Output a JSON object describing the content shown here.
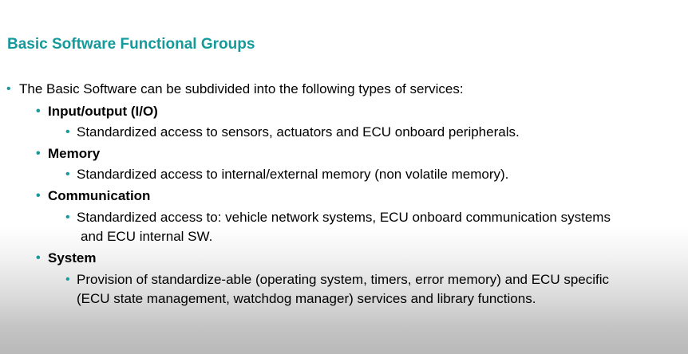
{
  "title": "Basic Software Functional Groups",
  "intro": "The Basic Software can be subdivided into the following types of services:",
  "groups": [
    {
      "name": "Input/output (I/O)",
      "details": [
        "Standardized access to sensors, actuators and ECU onboard peripherals."
      ]
    },
    {
      "name": "Memory",
      "details": [
        "Standardized access to internal/external memory (non volatile memory)."
      ]
    },
    {
      "name": "Communication",
      "details": [
        "Standardized access to: vehicle network systems, ECU onboard communication systems",
        "and ECU internal SW."
      ]
    },
    {
      "name": "System",
      "details": [
        "Provision of standardize-able (operating system, timers, error memory) and ECU specific",
        "(ECU state management, watchdog manager) services and library functions."
      ]
    }
  ]
}
